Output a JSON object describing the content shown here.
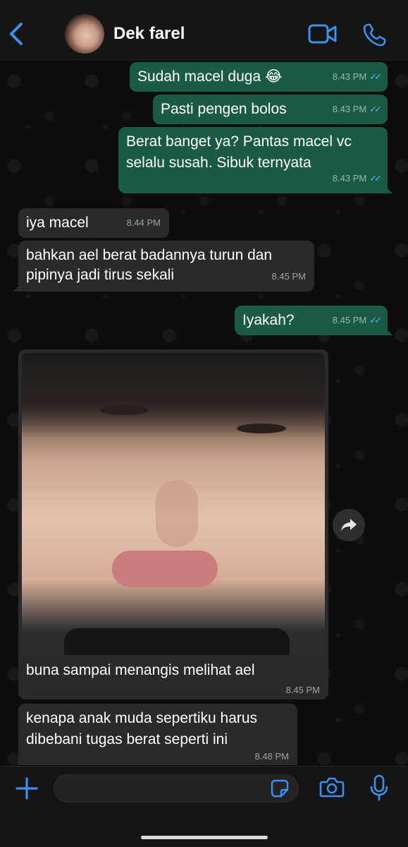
{
  "header": {
    "contact_name": "Dek farel"
  },
  "messages": [
    {
      "dir": "out",
      "lines": [
        "Sudah macel duga 😂"
      ],
      "time": "8.43 PM",
      "read": true
    },
    {
      "dir": "out",
      "lines": [
        "Pasti pengen bolos"
      ],
      "time": "8.43 PM",
      "read": true
    },
    {
      "dir": "out",
      "lines": [
        "Berat banget ya? Pantas macel vc",
        "selalu susah. Sibuk ternyata"
      ],
      "time": "8.43 PM",
      "read": true
    },
    {
      "dir": "in",
      "lines": [
        "iya macel"
      ],
      "time": "8.44 PM"
    },
    {
      "dir": "in",
      "lines": [
        "bahkan ael berat badannya turun dan",
        "pipinya jadi tirus sekali"
      ],
      "time": "8.45 PM"
    },
    {
      "dir": "out",
      "lines": [
        "Iyakah?"
      ],
      "time": "8.45 PM",
      "read": true
    },
    {
      "dir": "in",
      "type": "image",
      "caption": "buna sampai menangis melihat ael",
      "time": "8.45 PM"
    },
    {
      "dir": "in",
      "lines": [
        "kenapa anak muda sepertiku harus",
        "dibebani tugas berat seperti ini"
      ],
      "time": "8.48 PM"
    }
  ],
  "colors": {
    "outgoing_bubble": "#1c5b43",
    "incoming_bubble": "#2a2a2c",
    "accent_blue": "#3d8ff0",
    "read_ticks": "#5ab3f2"
  },
  "icons": {
    "back": "chevron-left-icon",
    "video": "video-camera-icon",
    "call": "phone-icon",
    "forward": "forward-arrow-icon",
    "plus": "plus-icon",
    "sticker": "sticker-icon",
    "camera": "camera-icon",
    "mic": "microphone-icon"
  }
}
